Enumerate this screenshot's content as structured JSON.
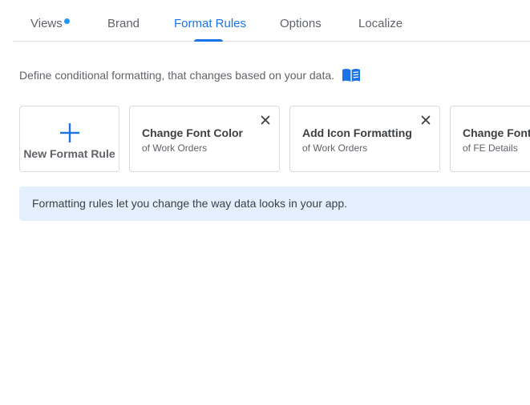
{
  "tabs": [
    {
      "label": "Views",
      "has_indicator": true
    },
    {
      "label": "Brand"
    },
    {
      "label": "Format Rules",
      "active": true
    },
    {
      "label": "Options"
    },
    {
      "label": "Localize"
    }
  ],
  "intro": {
    "text": "Define conditional formatting, that changes based on your data.",
    "icon": "book-icon"
  },
  "new_rule": {
    "label": "New Format Rule",
    "icon": "plus-icon"
  },
  "rules": [
    {
      "title": "Change Font Color",
      "subtitle": "of Work Orders"
    },
    {
      "title": "Add Icon Formatting",
      "subtitle": "of Work Orders"
    },
    {
      "title": "Change Font",
      "subtitle": "of FE Details"
    }
  ],
  "info_banner": {
    "text": "Formatting rules let you change the way data looks in your app."
  },
  "colors": {
    "accent": "#1a73e8",
    "indicator": "#2196f3",
    "banner_bg": "#e3effd",
    "border": "#dadce0"
  }
}
